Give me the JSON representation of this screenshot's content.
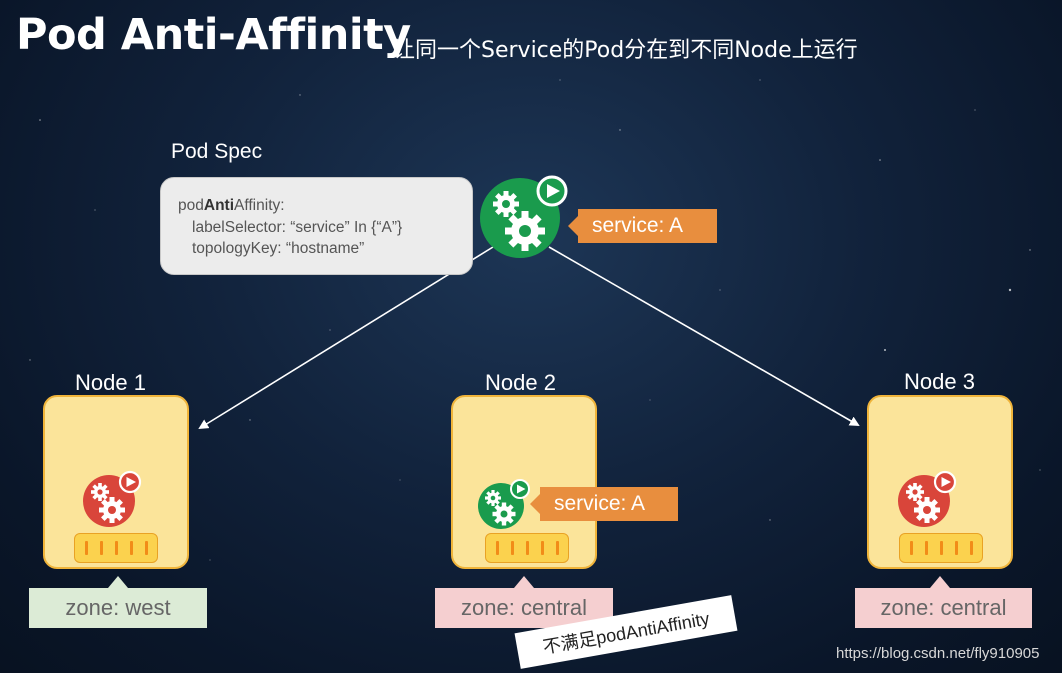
{
  "header": {
    "title": "Pod Anti-Affinity",
    "subtitle": "让同一个Service的Pod分在到不同Node上运行"
  },
  "pod_spec": {
    "label": "Pod Spec",
    "line1_prefix": "pod",
    "line1_bold": "Anti",
    "line1_suffix": "Affinity:",
    "line2": "labelSelector: “service” In {“A”}",
    "line3": "topologyKey: “hostname”"
  },
  "new_pod": {
    "service_tag": "service: A",
    "color": "#1a9b4d"
  },
  "nodes": [
    {
      "label": "Node 1",
      "zone": "zone: west",
      "zone_color": "#dcebd6",
      "pod_color": "#d9453a",
      "result": "placed"
    },
    {
      "label": "Node 2",
      "zone": "zone: central",
      "zone_color": "#f5cfd0",
      "pod_color": "#1a9b4d",
      "service_tag": "service: A",
      "result": "rejected"
    },
    {
      "label": "Node 3",
      "zone": "zone: central",
      "zone_color": "#f5cfd0",
      "pod_color": "#d9453a",
      "result": "placed"
    }
  ],
  "note": "不满足podAntiAffinity",
  "watermark": "https://blog.csdn.net/fly910905",
  "colors": {
    "background": "#11223b",
    "service_tag": "#e88e3e",
    "node_fill": "#fbe49a",
    "node_border": "#f0b43a"
  }
}
